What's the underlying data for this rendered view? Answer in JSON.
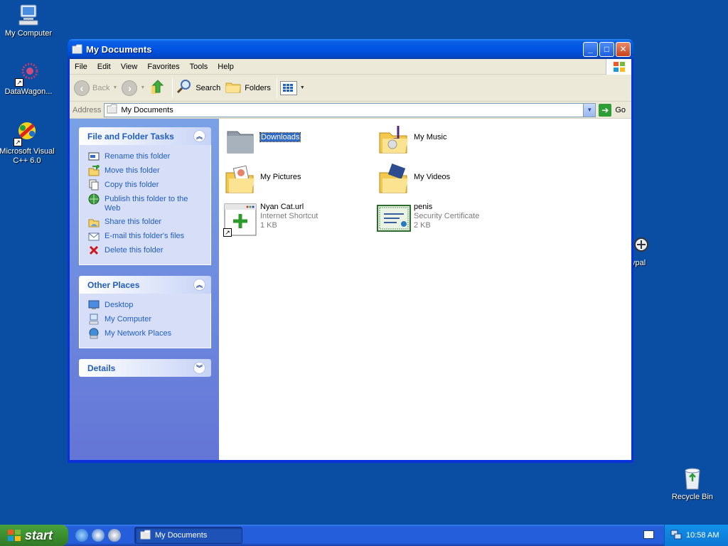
{
  "desktop": {
    "icons": [
      {
        "label": "My Computer"
      },
      {
        "label": "DataWagon..."
      },
      {
        "label": "Microsoft Visual C++ 6.0"
      },
      {
        "label": "Recycle Bin"
      }
    ],
    "partial_icon_label": "ypal"
  },
  "window": {
    "title": "My Documents",
    "controls": {
      "minimize": "_",
      "maximize": "□",
      "close": "✕"
    }
  },
  "menu": [
    "File",
    "Edit",
    "View",
    "Favorites",
    "Tools",
    "Help"
  ],
  "toolbar": {
    "back": "Back",
    "search": "Search",
    "folders": "Folders"
  },
  "address": {
    "label": "Address",
    "value": "My Documents",
    "go": "Go"
  },
  "tasks": {
    "file_folder": {
      "title": "File and Folder Tasks",
      "items": [
        {
          "label": "Rename this folder",
          "icon": "rename-icon"
        },
        {
          "label": "Move this folder",
          "icon": "move-icon"
        },
        {
          "label": "Copy this folder",
          "icon": "copy-icon"
        },
        {
          "label": "Publish this folder to the Web",
          "icon": "globe-icon"
        },
        {
          "label": "Share this folder",
          "icon": "share-icon"
        },
        {
          "label": "E-mail this folder's files",
          "icon": "email-icon"
        },
        {
          "label": "Delete this folder",
          "icon": "delete-icon"
        }
      ]
    },
    "other_places": {
      "title": "Other Places",
      "items": [
        {
          "label": "Desktop",
          "icon": "desktop-icon"
        },
        {
          "label": "My Computer",
          "icon": "computer-icon"
        },
        {
          "label": "My Network Places",
          "icon": "network-icon"
        }
      ]
    },
    "details": {
      "title": "Details"
    }
  },
  "files": [
    {
      "name": "Downloads",
      "type": "",
      "size": "",
      "selected": true
    },
    {
      "name": "My Music",
      "type": "",
      "size": ""
    },
    {
      "name": "My Pictures",
      "type": "",
      "size": ""
    },
    {
      "name": "My Videos",
      "type": "",
      "size": ""
    },
    {
      "name": "Nyan Cat.url",
      "type": "Internet Shortcut",
      "size": "1 KB"
    },
    {
      "name": "penis",
      "type": "Security Certificate",
      "size": "2 KB"
    }
  ],
  "taskbar": {
    "start": "start",
    "task": "My Documents",
    "clock": "10:58 AM"
  },
  "colors": {
    "desktop": "#0a4ea3",
    "titlebar": "#0054e3",
    "task_link": "#215dc6",
    "selection": "#316ac5"
  }
}
